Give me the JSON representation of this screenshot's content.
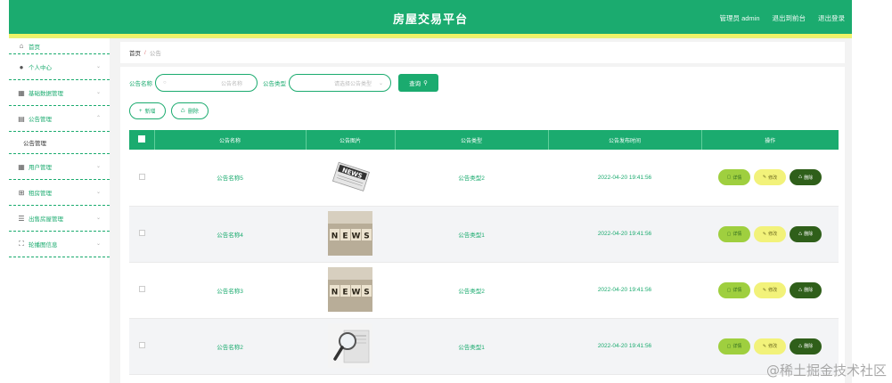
{
  "header": {
    "title": "房屋交易平台",
    "admin_label": "管理员 admin",
    "back_front_label": "退出到前台",
    "logout_label": "退出登录"
  },
  "sidebar": {
    "items": [
      {
        "label": "首页",
        "icon": "home-icon"
      },
      {
        "label": "个人中心",
        "icon": "user-icon"
      },
      {
        "label": "基础数据管理",
        "icon": "grid-icon"
      },
      {
        "label": "公告管理",
        "icon": "notice-icon"
      },
      {
        "label": "用户管理",
        "icon": "users-icon"
      },
      {
        "label": "租房管理",
        "icon": "crop-icon"
      },
      {
        "label": "出售房屋管理",
        "icon": "list-icon"
      },
      {
        "label": "轮播图信息",
        "icon": "expand-icon"
      }
    ],
    "sub_item": "公告管理"
  },
  "breadcrumb": {
    "home": "首页",
    "separator": "/",
    "current": "公告"
  },
  "search": {
    "name_label": "公告名称",
    "name_placeholder": "公告名称",
    "type_label": "公告类型",
    "type_placeholder": "请选择公告类型",
    "search_button": "查询"
  },
  "actions": {
    "add": "新增",
    "delete": "删除"
  },
  "table": {
    "headers": [
      "公告名称",
      "公告图片",
      "公告类型",
      "公告发布时间",
      "操作"
    ],
    "rows": [
      {
        "name": "公告名称5",
        "type": "公告类型2",
        "time": "2022-04-20 19:41:56",
        "image": "newspaper"
      },
      {
        "name": "公告名称4",
        "type": "公告类型1",
        "time": "2022-04-20 19:41:56",
        "image": "news-blocks"
      },
      {
        "name": "公告名称3",
        "type": "公告类型2",
        "time": "2022-04-20 19:41:56",
        "image": "news-blocks"
      },
      {
        "name": "公告名称2",
        "type": "公告类型1",
        "time": "2022-04-20 19:41:56",
        "image": "magnifier"
      }
    ],
    "row_buttons": {
      "view": "详情",
      "edit": "修改",
      "delete": "删除"
    }
  },
  "watermark": "@稀土掘金技术社区",
  "colors": {
    "primary": "#1bab6f",
    "accent_yellow": "#f3f55c",
    "view": "#9fcf3f",
    "edit": "#f2f27a",
    "del": "#2f5f1a"
  }
}
